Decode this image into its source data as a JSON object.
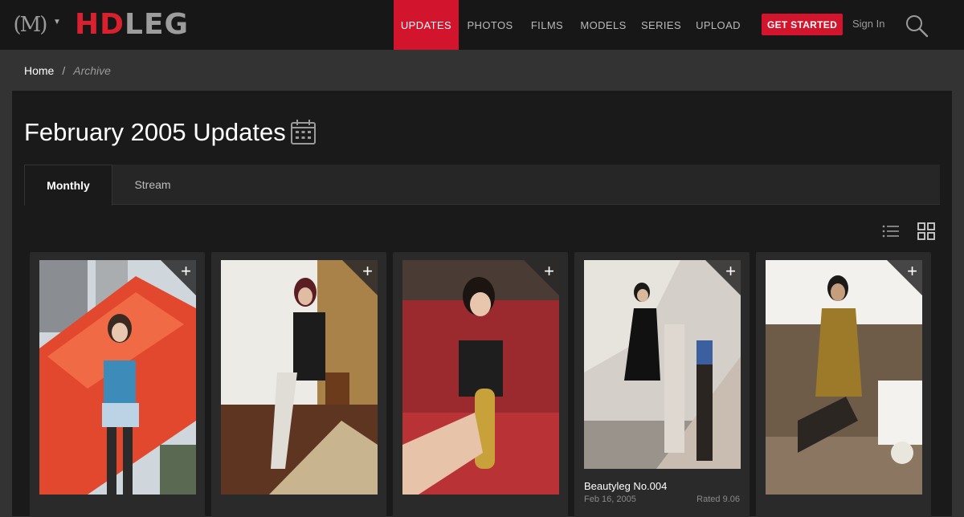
{
  "header": {
    "logo_mark": "(M)",
    "brand_red": "HD",
    "brand_grey": "LEG",
    "nav": [
      {
        "label": "UPDATES",
        "active": true
      },
      {
        "label": "PHOTOS",
        "active": false
      },
      {
        "label": "FILMS",
        "active": false
      },
      {
        "label": "MODELS",
        "active": false
      },
      {
        "label": "SERIES",
        "active": false
      },
      {
        "label": "UPLOAD",
        "active": false
      }
    ],
    "cta_label": "GET STARTED",
    "sign_in_label": "Sign In",
    "search_icon": "search-icon"
  },
  "breadcrumb": {
    "home": "Home",
    "separator": "/",
    "current": "Archive"
  },
  "page": {
    "title": "February 2005 Updates",
    "title_icon": "calendar-icon"
  },
  "tabs": [
    {
      "label": "Monthly",
      "active": true
    },
    {
      "label": "Stream",
      "active": false
    }
  ],
  "view_toggle": {
    "list_icon": "list-view-icon",
    "grid_icon": "grid-view-icon"
  },
  "cards": [
    {
      "plus": "+",
      "title": "",
      "date": "",
      "rating": ""
    },
    {
      "plus": "+",
      "title": "",
      "date": "",
      "rating": ""
    },
    {
      "plus": "+",
      "title": "",
      "date": "",
      "rating": ""
    },
    {
      "plus": "+",
      "title": "Beautyleg No.004",
      "date": "Feb 16, 2005",
      "rating": "Rated 9.06"
    },
    {
      "plus": "+",
      "title": "",
      "date": "",
      "rating": ""
    }
  ],
  "colors": {
    "accent": "#d2142c",
    "header_bg": "#171717",
    "page_bg": "#333333",
    "panel_bg": "#1a1a1a"
  }
}
